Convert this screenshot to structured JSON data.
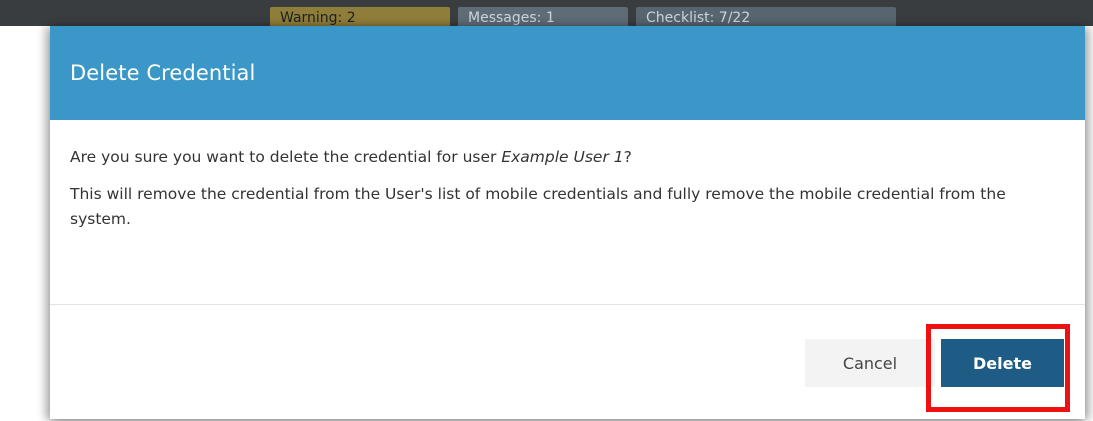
{
  "backdrop": {
    "badges": [
      "Warning: 2",
      "Messages: 1",
      "Checklist: 7/22"
    ]
  },
  "dialog": {
    "title": "Delete Credential",
    "message": {
      "prefix": "Are you sure you want to delete the credential for user ",
      "user_name": "Example User 1",
      "suffix": "?"
    },
    "description": "This will remove the credential from the User's list of mobile credentials and fully remove the mobile credential from the system.",
    "buttons": {
      "cancel": "Cancel",
      "delete": "Delete"
    }
  },
  "colors": {
    "header": "#3a97c8",
    "primary_button": "#1e5c85",
    "highlight": "#ee1111"
  }
}
